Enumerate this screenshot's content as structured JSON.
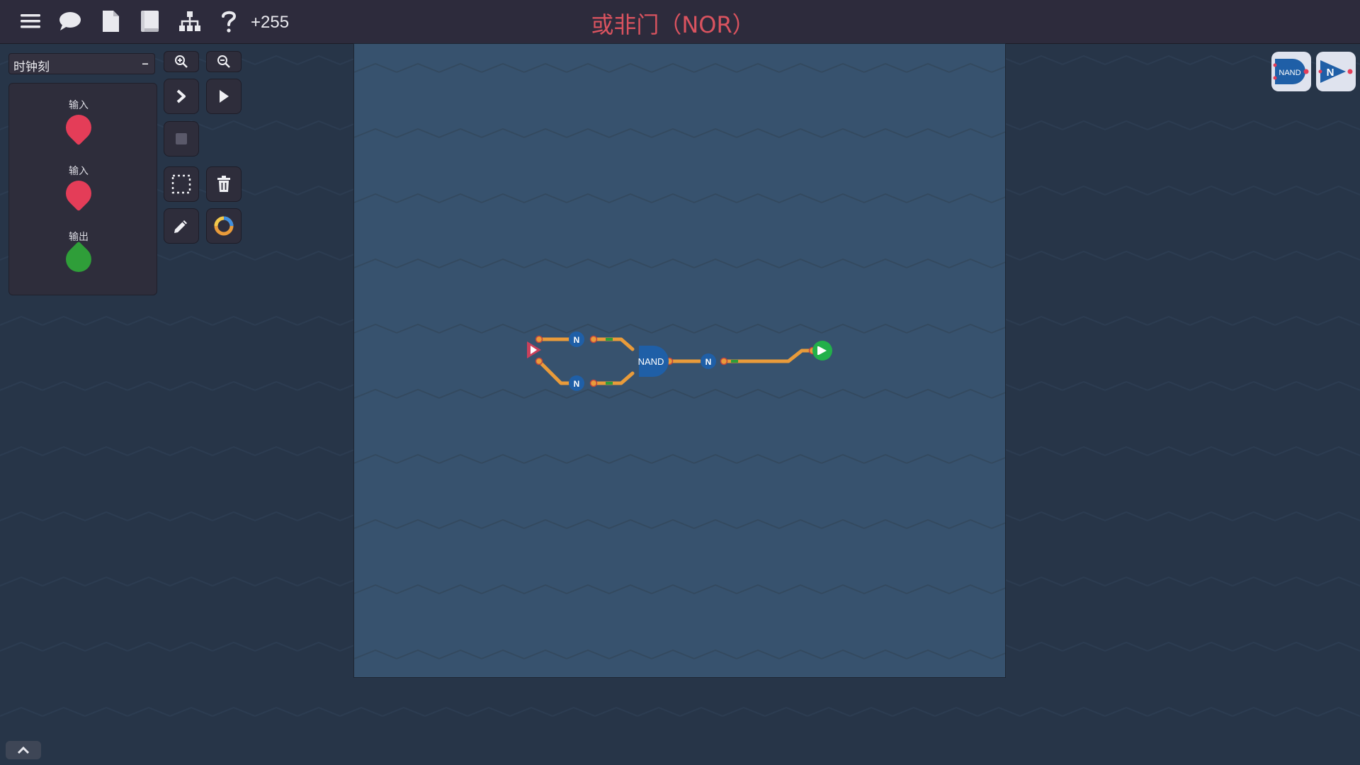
{
  "toolbar": {
    "score": "+255",
    "icons": [
      "menu-icon",
      "chat-icon",
      "file-icon",
      "book-icon",
      "hierarchy-icon",
      "help-icon"
    ]
  },
  "level": {
    "title": "或非门（NOR）"
  },
  "sidebar": {
    "clock_label": "时钟刻",
    "clock_minus": "–",
    "io": [
      {
        "label": "输入",
        "color": "#e43d58"
      },
      {
        "label": "输入",
        "color": "#e43d58"
      },
      {
        "label": "输出",
        "color": "#2f9e39"
      }
    ]
  },
  "tools": [
    "zoom-in",
    "zoom-out",
    "step",
    "play",
    "stop",
    "select",
    "delete",
    "pencil",
    "color"
  ],
  "components": [
    {
      "label": "NAND"
    },
    {
      "label": "N"
    }
  ],
  "circuit": {
    "gate_nand": "NAND",
    "gate_not_1": "N",
    "gate_not_2": "N",
    "gate_not_3": "N"
  },
  "colors": {
    "wire": "#e99b3a",
    "gate": "#1f5fa7",
    "input": "#e43d58",
    "output": "#22b04a",
    "accent_title": "#d9535f"
  }
}
